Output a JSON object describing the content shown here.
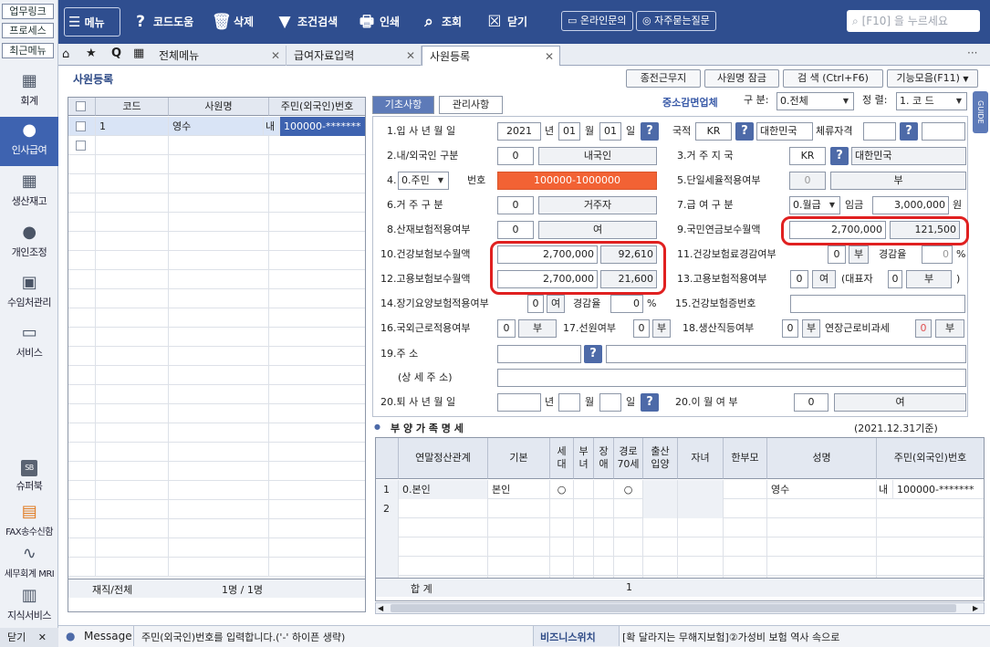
{
  "rail": {
    "top_buttons": [
      "업무링크",
      "프로세스",
      "최근메뉴"
    ],
    "nav": [
      "회계",
      "인사급여",
      "생산재고",
      "개인조정",
      "수임처관리",
      "서비스"
    ],
    "bottom_nav": [
      "슈퍼북",
      "FAX송수신함",
      "세무회계 MRI",
      "지식서비스"
    ],
    "close_label": "닫기",
    "sb_badge": "SB"
  },
  "toolbar": {
    "menu": "메뉴",
    "code_help": "코드도움",
    "delete": "삭제",
    "filter": "조건검색",
    "print": "인쇄",
    "lookup": "조회",
    "close": "닫기",
    "online_inquiry": "온라인문의",
    "faq": "자주묻는질문",
    "search_placeholder": "[F10] 을 누르세요"
  },
  "tabs": {
    "all_menu": "전체메뉴",
    "salary_input": "급여자료입력",
    "employee_reg": "사원등록"
  },
  "page": {
    "title": "사원등록",
    "btn_prev_work": "종전근무지",
    "btn_lock": "사원명 잠금",
    "btn_search": "검 색 (Ctrl+F6)",
    "btn_functions": "기능모음(F11)",
    "sme_label": "중소감면업체",
    "category_label": "구 분:",
    "category_value": "0.전체",
    "sort_label": "정 렬:",
    "sort_value": "1. 코 드",
    "guide": "GUIDE"
  },
  "list": {
    "headers": [
      "코드",
      "사원명",
      "주민(외국인)번호"
    ],
    "rows": [
      {
        "code": "1",
        "name": "영수",
        "type": "내",
        "id": "100000-*******"
      }
    ],
    "footer_label": "재직/전체",
    "footer_value": "1명 / 1명"
  },
  "form": {
    "tab_basic": "기초사항",
    "tab_manage": "관리사항",
    "f1_label": "1.입 사 년 월 일",
    "f1_year": "2021",
    "f1_y": "년",
    "f1_month": "01",
    "f1_m": "월",
    "f1_day": "01",
    "f1_d": "일",
    "nation_label": "국적",
    "nation_code": "KR",
    "nation_name": "대한민국",
    "stay_label": "체류자격",
    "f2_label": "2.내/외국인 구분",
    "f2_code": "0",
    "f2_value": "내국인",
    "f3_label": "3.거 주 지 국",
    "f3_code": "KR",
    "f3_name": "대한민국",
    "f4_select": "0.주민",
    "f4_label": "번호",
    "f4_value": "100000-1000000",
    "f5_label": "5.단일세율적용여부",
    "f5_code": "0",
    "f5_value": "부",
    "f6_label": "6.거 주 구 분",
    "f6_code": "0",
    "f6_value": "거주자",
    "f7_label": "7.급 여 구 분",
    "f7_select": "0.월급",
    "f7_wage_label": "임금",
    "f7_wage": "3,000,000",
    "f7_unit": "원",
    "f8_label": "8.산재보험적용여부",
    "f8_code": "0",
    "f8_value": "여",
    "f9_label": "9.국민연금보수월액",
    "f9_amount": "2,700,000",
    "f9_premium": "121,500",
    "f10_label": "10.건강보험보수월액",
    "f10_amount": "2,700,000",
    "f10_premium": "92,610",
    "f11_label": "11.건강보험료경감여부",
    "f11_code": "0",
    "f11_value": "부",
    "f11_rate_label": "경감율",
    "f11_rate": "0",
    "f11_pct": "%",
    "f12_label": "12.고용보험보수월액",
    "f12_amount": "2,700,000",
    "f12_premium": "21,600",
    "f13_label": "13.고용보험적용여부",
    "f13_code": "0",
    "f13_value": "여",
    "f13_rep_label": "(대표자",
    "f13_rep_code": "0",
    "f13_rep_value": "부",
    "f13_close": ")",
    "f14_label": "14.장기요양보험적용여부",
    "f14_code": "0",
    "f14_value": "여",
    "f14_rate_label": "경감율",
    "f14_rate": "0",
    "f14_pct": "%",
    "f15_label": "15.건강보험증번호",
    "f16_label": "16.국외근로적용여부",
    "f16_code": "0",
    "f16_value": "부",
    "f17_label": "17.선원여부",
    "f17_code": "0",
    "f17_value": "부",
    "f18_label": "18.생산직등여부",
    "f18_code": "0",
    "f18_value": "부",
    "f18_ot_label": "연장근로비과세",
    "f18_ot_code": "0",
    "f18_ot_value": "부",
    "f19_label": "19.주 소",
    "f19_detail_label": "(상 세 주 소)",
    "f20_label": "20.퇴 사 년 월 일",
    "f20_y": "년",
    "f20_m": "월",
    "f20_d": "일",
    "f21_label": "20.이 월 여 부",
    "f21_code": "0",
    "f21_value": "여"
  },
  "dependents": {
    "title": "부 양 가 족 명 세",
    "date": "(2021.12.31기준)",
    "headers": [
      "연말정산관계",
      "기본",
      "세대",
      "부녀",
      "장애",
      "경로70세",
      "출산입양",
      "자녀",
      "한부모",
      "성명",
      "주민(외국인)번호"
    ],
    "rows": [
      {
        "no": "1",
        "relation": "0.본인",
        "basic": "본인",
        "household": "○",
        "senior": "○",
        "name": "영수",
        "type": "내",
        "id": "100000-*******"
      },
      {
        "no": "2"
      }
    ],
    "total_label": "합 계",
    "total_senior": "1"
  },
  "status": {
    "message_label": "Message",
    "message": "주민(외국인)번호를 입력합니다.('-' 하이픈 생략)",
    "biz_label": "비즈니스위치",
    "biz_news": "[확 달라지는 무해지보험]②가성비 보험 역사 속으로"
  }
}
